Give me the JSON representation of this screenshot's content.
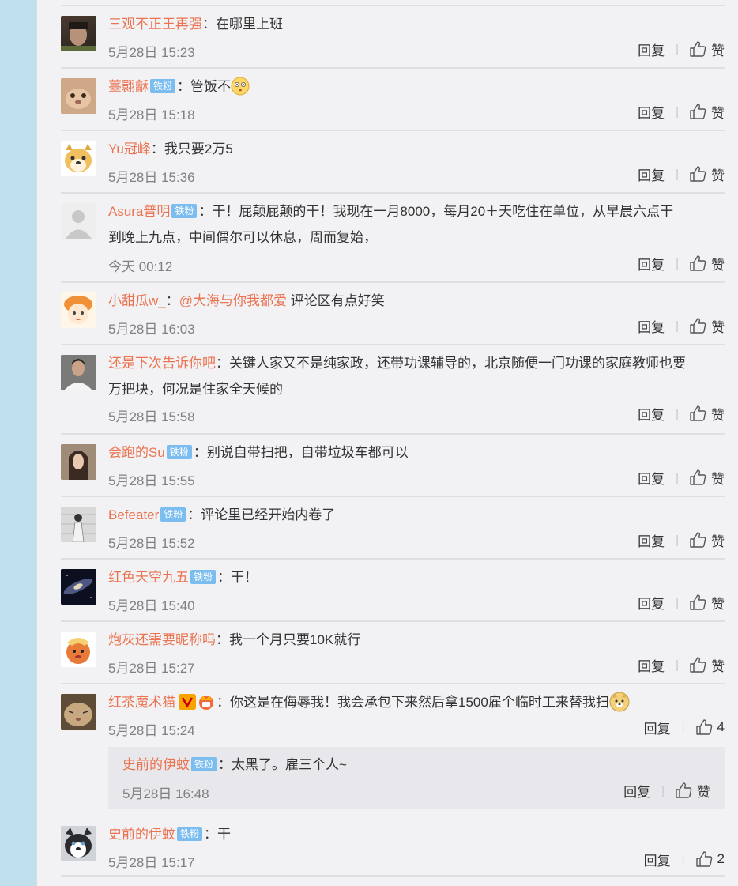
{
  "common": {
    "reply_label": "回复",
    "like_label": "赞",
    "sep_char": "|",
    "colon": "："
  },
  "comments": [
    {
      "user": "三观不正王再强",
      "badges": [],
      "text": "在哪里上班",
      "time": "5月28日 15:23",
      "like": "赞"
    },
    {
      "user": "薹翾龢",
      "badges": [
        "铁粉"
      ],
      "text": "管饭不",
      "emoji": "flushed-emoji",
      "time": "5月28日 15:18",
      "like": "赞"
    },
    {
      "user": "Yu冠峰",
      "badges": [],
      "text": "我只要2万5",
      "time": "5月28日 15:36",
      "like": "赞"
    },
    {
      "user": "Asura普明",
      "badges": [
        "铁粉"
      ],
      "text1": "干！屁颠屁颠的干！我现在一月8000，每月20＋天吃住在单位，从早晨六点干",
      "text2": "到晚上九点，中间偶尔可以休息，周而复始，",
      "time": "今天 00:12",
      "like": "赞"
    },
    {
      "user": "小甜瓜w_",
      "mention": "@大海与你我都爱",
      "text": " 评论区有点好笑",
      "time": "5月28日 16:03",
      "like": "赞"
    },
    {
      "user": "还是下次告诉你吧",
      "text1": "关键人家又不是纯家政，还带功课辅导的，北京随便一门功课的家庭教师也要",
      "text2": "万把块，何况是住家全天候的",
      "time": "5月28日 15:58",
      "like": "赞"
    },
    {
      "user": "会跑的Su",
      "badges": [
        "铁粉"
      ],
      "text": "别说自带扫把，自带垃圾车都可以",
      "time": "5月28日 15:55",
      "like": "赞"
    },
    {
      "user": "Befeater",
      "badges": [
        "铁粉"
      ],
      "text": "评论里已经开始内卷了",
      "time": "5月28日 15:52",
      "like": "赞"
    },
    {
      "user": "红色天空九五",
      "badges": [
        "铁粉"
      ],
      "text": "干！",
      "time": "5月28日 15:40",
      "like": "赞"
    },
    {
      "user": "炮灰还需要昵称吗",
      "text": "我一个月只要10K就行",
      "time": "5月28日 15:27",
      "like": "赞"
    },
    {
      "user": "红茶魔术猫",
      "badges_icons": [
        "vip-v-icon",
        "fan-crown-icon"
      ],
      "text": "你这是在侮辱我！我会承包下来然后拿1500雇个临时工来替我扫",
      "emoji": "doge-emoji",
      "time": "5月28日 15:24",
      "like": "4"
    },
    {
      "user": "史前的伊蚊",
      "badges": [
        "铁粉"
      ],
      "text": "太黑了。雇三个人~",
      "time": "5月28日 16:48",
      "like": "赞"
    },
    {
      "user": "史前的伊蚊",
      "badges": [
        "铁粉"
      ],
      "text": "干",
      "time": "5月28日 15:17",
      "like": "2"
    }
  ]
}
